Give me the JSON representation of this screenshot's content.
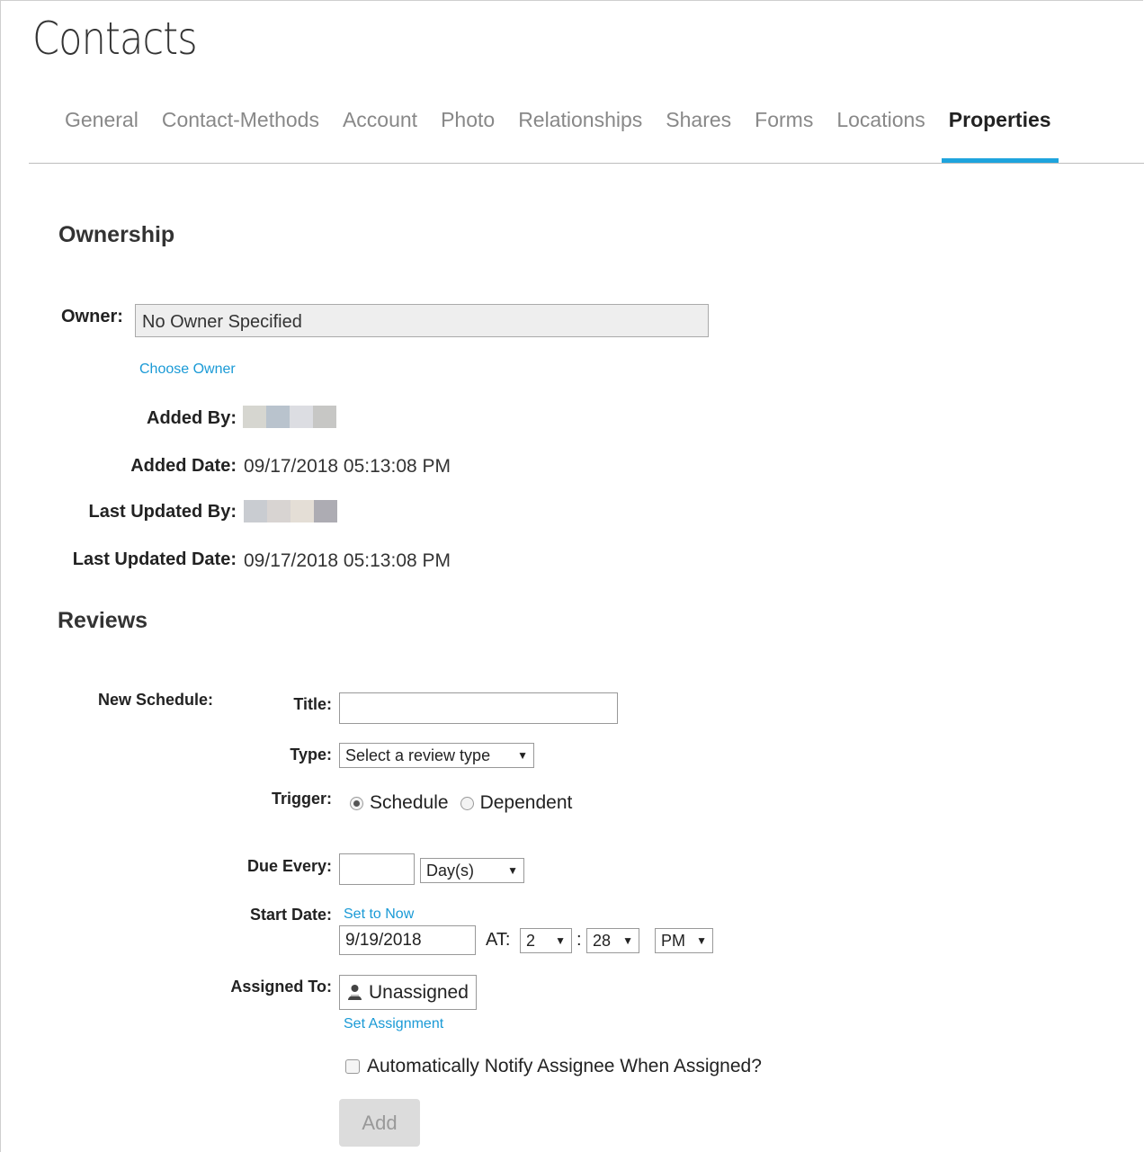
{
  "page": {
    "title": "Contacts"
  },
  "tabs": [
    {
      "label": "General"
    },
    {
      "label": "Contact-Methods"
    },
    {
      "label": "Account"
    },
    {
      "label": "Photo"
    },
    {
      "label": "Relationships"
    },
    {
      "label": "Shares"
    },
    {
      "label": "Forms"
    },
    {
      "label": "Locations"
    },
    {
      "label": "Properties",
      "active": true
    }
  ],
  "ownership": {
    "heading": "Ownership",
    "owner_label": "Owner:",
    "owner_value": "No Owner Specified",
    "choose_owner_link": "Choose Owner",
    "added_by_label": "Added By:",
    "added_date_label": "Added Date:",
    "added_date_value": "09/17/2018 05:13:08 PM",
    "last_updated_by_label": "Last Updated By:",
    "last_updated_date_label": "Last Updated Date:",
    "last_updated_date_value": "09/17/2018 05:13:08 PM",
    "redaction_colors": {
      "added_by": [
        "#d6d6d0",
        "#b9c3cd",
        "#dcdde2",
        "#c7c7c5"
      ],
      "last_updated_by": [
        "#c9ccd1",
        "#d8d4d2",
        "#e4ded6",
        "#adacb3"
      ]
    }
  },
  "reviews": {
    "heading": "Reviews",
    "new_schedule_label": "New Schedule:",
    "title_label": "Title:",
    "title_value": "",
    "type_label": "Type:",
    "type_selected": "Select a review type",
    "trigger_label": "Trigger:",
    "trigger_options": [
      {
        "label": "Schedule",
        "checked": true
      },
      {
        "label": "Dependent",
        "checked": false
      }
    ],
    "due_every_label": "Due Every:",
    "due_every_value": "",
    "due_unit_selected": "Day(s)",
    "start_date_label": "Start Date:",
    "set_to_now_link": "Set to Now",
    "start_date_value": "9/19/2018",
    "at_label": "AT:",
    "hour_selected": "2",
    "time_separator": ":",
    "minute_selected": "28",
    "ampm_selected": "PM",
    "assigned_to_label": "Assigned To:",
    "assigned_to_value": "Unassigned",
    "set_assignment_link": "Set Assignment",
    "notify_label": "Automatically Notify Assignee When Assigned?",
    "notify_checked": false,
    "add_button": "Add"
  },
  "colors": {
    "accent": "#1ea4dd",
    "link": "#1a9ad6"
  },
  "icons": {
    "assignee": "person-icon",
    "dropdown": "dropdown-arrow-icon"
  }
}
